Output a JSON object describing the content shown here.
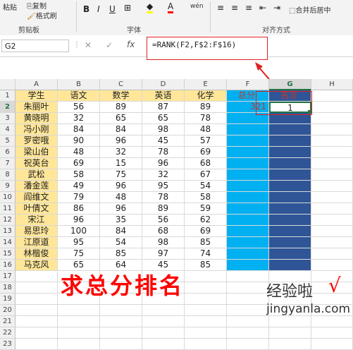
{
  "ribbon": {
    "paste_label": "粘贴",
    "copy_label": "复制",
    "format_painter_label": "格式刷",
    "clipboard_group": "剪贴板",
    "font_group": "字体",
    "align_group": "对齐方式",
    "bold": "B",
    "italic": "I",
    "underline": "U",
    "merge_label": "合并后居中"
  },
  "formula_bar": {
    "name_box": "G2",
    "cancel_icon": "✕",
    "enter_icon": "✓",
    "fx_icon": "fx",
    "formula": "=RANK(F2,F$2:F$16)"
  },
  "columns": [
    "A",
    "B",
    "C",
    "D",
    "E",
    "F",
    "G",
    "H"
  ],
  "headers": [
    "学生",
    "语文",
    "数学",
    "英语",
    "化学",
    "总分",
    "名次"
  ],
  "rows": [
    [
      "朱丽叶",
      "56",
      "89",
      "87",
      "89",
      "321",
      "1"
    ],
    [
      "黄晓明",
      "32",
      "65",
      "65",
      "78",
      "",
      ""
    ],
    [
      "冯小刚",
      "84",
      "84",
      "98",
      "48",
      "",
      ""
    ],
    [
      "罗密哦",
      "90",
      "96",
      "45",
      "57",
      "",
      ""
    ],
    [
      "梁山伯",
      "48",
      "32",
      "78",
      "69",
      "",
      ""
    ],
    [
      "祝英台",
      "69",
      "15",
      "96",
      "68",
      "",
      ""
    ],
    [
      "武松",
      "58",
      "75",
      "32",
      "67",
      "",
      ""
    ],
    [
      "潘金莲",
      "49",
      "96",
      "95",
      "54",
      "",
      ""
    ],
    [
      "阎维文",
      "79",
      "48",
      "78",
      "58",
      "",
      ""
    ],
    [
      "叶倩文",
      "86",
      "96",
      "89",
      "59",
      "",
      ""
    ],
    [
      "宋江",
      "96",
      "35",
      "56",
      "62",
      "",
      ""
    ],
    [
      "易思玲",
      "100",
      "84",
      "68",
      "69",
      "",
      ""
    ],
    [
      "江原道",
      "95",
      "54",
      "98",
      "85",
      "",
      ""
    ],
    [
      "林楷俊",
      "75",
      "85",
      "97",
      "74",
      "",
      ""
    ],
    [
      "马克风",
      "65",
      "64",
      "45",
      "85",
      "",
      ""
    ]
  ],
  "row_numbers": [
    "1",
    "2",
    "3",
    "4",
    "5",
    "6",
    "7",
    "8",
    "9",
    "10",
    "11",
    "12",
    "13",
    "14",
    "15",
    "16",
    "17",
    "18",
    "19",
    "20",
    "21",
    "22",
    "23"
  ],
  "annotation": "求总分排名",
  "watermark": {
    "title": "经验啦",
    "url": "jingyanla.com",
    "check": "√"
  }
}
